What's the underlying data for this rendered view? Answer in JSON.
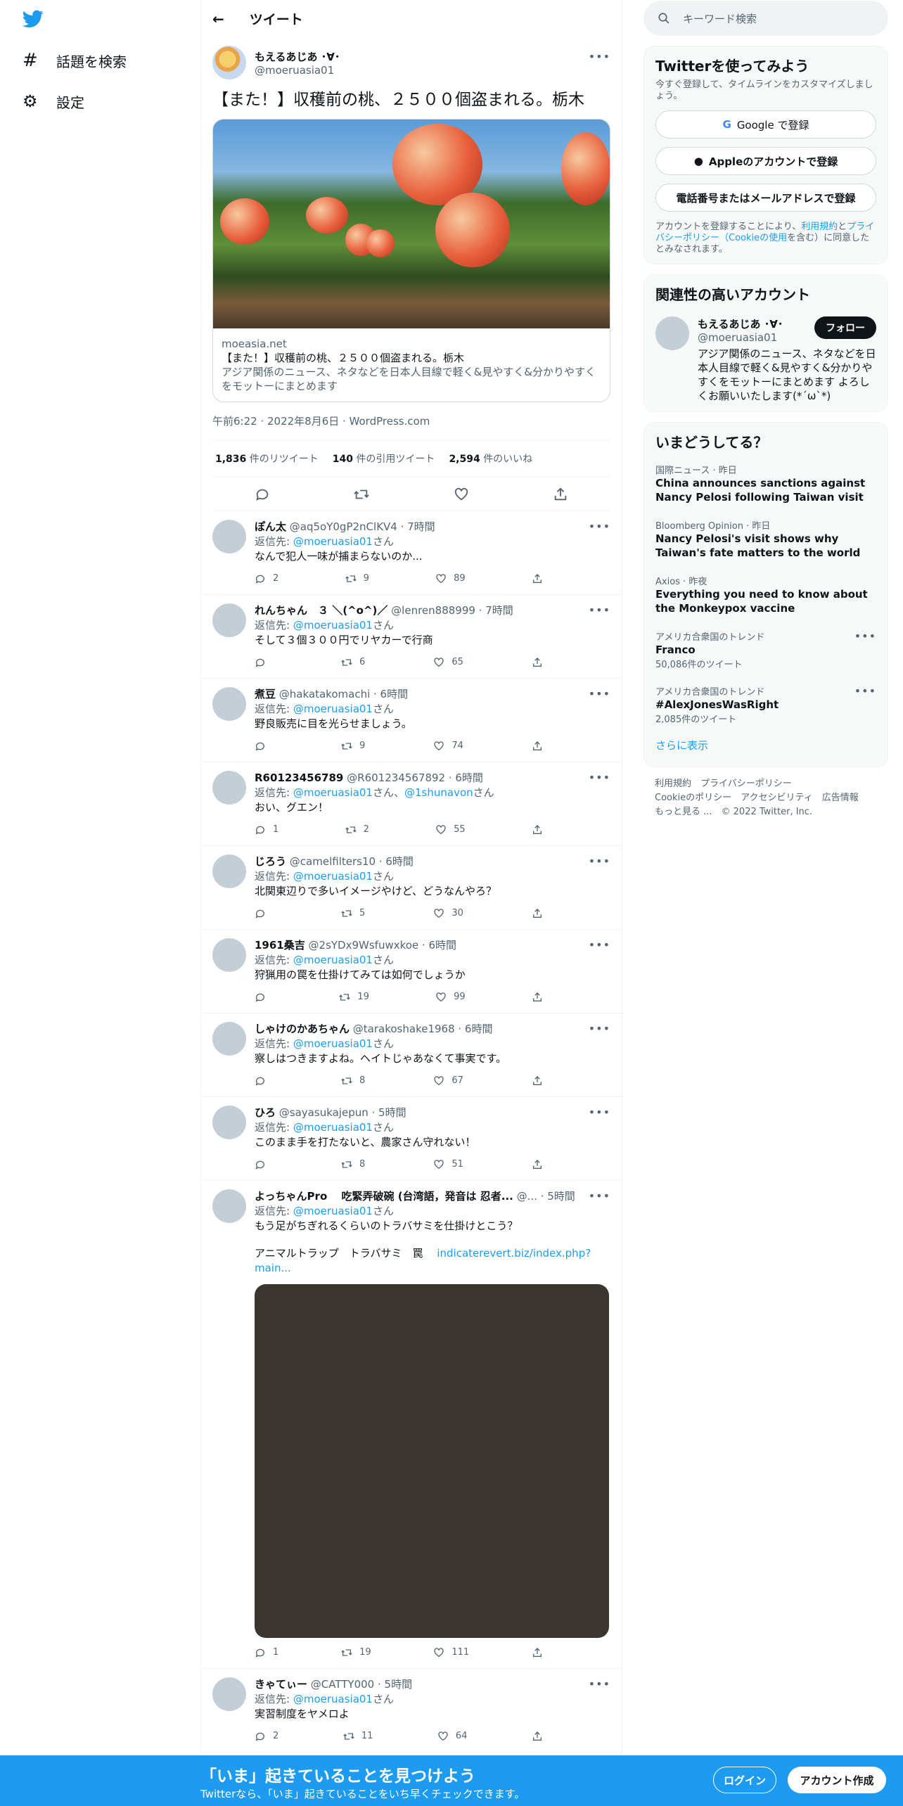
{
  "nav": {
    "explore": "話題を検索",
    "settings": "設定"
  },
  "header": {
    "title": "ツイート"
  },
  "main_tweet": {
    "name": "もえるあじあ ･∀･",
    "handle": "@moeruasia01",
    "text": "【また！】収穫前の桃、２５００個盗まれる。栃木",
    "card_domain": "moeasia.net",
    "card_title": "【また！】収穫前の桃、２５００個盗まれる。栃木",
    "card_desc": "アジア関係のニュース、ネタなどを日本人目線で軽く&見やすく&分かりやすくをモットーにまとめます",
    "meta": "午前6:22 · 2022年8月6日 · WordPress.com",
    "retweets": "1,836",
    "retweets_label": "件のリツイート",
    "quotes": "140",
    "quotes_label": "件の引用ツイート",
    "likes": "2,594",
    "likes_label": "件のいいね"
  },
  "replies": [
    {
      "name": "ぽん太",
      "handle": "@aq5oY0gP2nClKV4 · 7時間",
      "to": "@moeruasia01",
      "to2": "",
      "text": "なんで犯人一味が捕まらないのか...",
      "r": "2",
      "rt": "9",
      "l": "89"
    },
    {
      "name": "れんちゃん　３ ＼(^o^)／",
      "handle": "@lenren888999 · 7時間",
      "to": "@moeruasia01",
      "to2": "",
      "text": "そして３個３００円でリヤカーで行商",
      "r": "",
      "rt": "6",
      "l": "65"
    },
    {
      "name": "煮豆",
      "handle": "@hakatakomachi · 6時間",
      "to": "@moeruasia01",
      "to2": "",
      "text": "野良販売に目を光らせましょう。",
      "r": "",
      "rt": "9",
      "l": "74"
    },
    {
      "name": "R60123456789",
      "handle": "@R601234567892 · 6時間",
      "to": "@moeruasia01",
      "to2": "@1shunavon",
      "text": "おい、グエン！",
      "r": "1",
      "rt": "2",
      "l": "55"
    },
    {
      "name": "じろう",
      "handle": "@camelfilters10 · 6時間",
      "to": "@moeruasia01",
      "to2": "",
      "text": "北関東辺りで多いイメージやけど、どうなんやろ？",
      "r": "",
      "rt": "5",
      "l": "30"
    },
    {
      "name": "1961桑吉",
      "handle": "@2sYDx9Wsfuwxkoe · 6時間",
      "to": "@moeruasia01",
      "to2": "",
      "text": "狩猟用の罠を仕掛けてみては如何でしょうか",
      "r": "",
      "rt": "19",
      "l": "99"
    },
    {
      "name": "しゃけのかあちゃん",
      "handle": "@tarakoshake1968 · 6時間",
      "to": "@moeruasia01",
      "to2": "",
      "text": "察しはつきますよね。ヘイトじゃあなくて事実です。",
      "r": "",
      "rt": "8",
      "l": "67"
    },
    {
      "name": "ひろ",
      "handle": "@sayasukajepun · 5時間",
      "to": "@moeruasia01",
      "to2": "",
      "text": "このまま手を打たないと、農家さん守れない！",
      "r": "",
      "rt": "8",
      "l": "51"
    }
  ],
  "long_reply": {
    "name": "よっちゃんPro　 吃緊弄破碗 (台湾語，発音は 忍者...",
    "handle": "@... · 5時間",
    "to": "@moeruasia01",
    "text": "もう足がちぎれるくらいのトラバサミを仕掛けとこう？",
    "text2": "アニマルトラップ　トラバサミ　罠",
    "link": "indicaterevert.biz/index.php?main...",
    "r": "1",
    "rt": "19",
    "l": "111"
  },
  "last_reply": {
    "name": "きゃてぃー",
    "handle": "@CATTY000 · 5時間",
    "to": "@moeruasia01",
    "text": "実習制度をヤメロよ",
    "r": "2",
    "rt": "11",
    "l": "64"
  },
  "reply_prefix": "返信先: ",
  "reply_suffix": "さん",
  "reply_and": "さん、",
  "search": {
    "placeholder": "キーワード検索"
  },
  "signup_box": {
    "title": "Twitterを使ってみよう",
    "sub": "今すぐ登録して、タイムラインをカスタマイズしましょう。",
    "google": "Google で登録",
    "apple": "Appleのアカウントで登録",
    "phone": "電話番号またはメールアドレスで登録",
    "legal1": "アカウントを登録することにより、",
    "terms": "利用規約",
    "and": "と",
    "privacy": "プライバシーポリシー（Cookieの使用",
    "legal2": "を含む）に同意したとみなされます。"
  },
  "related": {
    "title": "関連性の高いアカウント",
    "name": "もえるあじあ ･∀･",
    "handle": "@moeruasia01",
    "follow": "フォロー",
    "bio": "アジア関係のニュース、ネタなどを日本人目線で軽く&見やすく&分かりやすくをモットーにまとめます よろしくお願いいたします(*´ω`*)"
  },
  "trends": {
    "title": "いまどうしてる？",
    "items": [
      {
        "t1": "国際ニュース · 昨日",
        "t2": "China announces sanctions against Nancy Pelosi following Taiwan visit",
        "t3": ""
      },
      {
        "t1": "Bloomberg Opinion · 昨日",
        "t2": "Nancy Pelosi's visit shows why Taiwan's fate matters to the world",
        "t3": ""
      },
      {
        "t1": "Axios · 昨夜",
        "t2": "Everything you need to know about the Monkeypox vaccine",
        "t3": ""
      },
      {
        "t1": "アメリカ合衆国のトレンド",
        "t2": "Franco",
        "t3": "50,086件のツイート"
      },
      {
        "t1": "アメリカ合衆国のトレンド",
        "t2": "#AlexJonesWasRight",
        "t3": "2,085件のツイート"
      }
    ],
    "more": "さらに表示"
  },
  "footer": {
    "l1": "利用規約　プライバシーポリシー",
    "l2": "Cookieのポリシー　アクセシビリティ　広告情報",
    "l3": "もっと見る ...　© 2022 Twitter, Inc."
  },
  "bottom": {
    "title": "「いま」起きていることを見つけよう",
    "sub": "Twitterなら、「いま」起きていることをいち早くチェックできます。",
    "login": "ログイン",
    "signup": "アカウント作成"
  },
  "colors": {
    "accent": "#1d9bf0",
    "text": "#0f1419",
    "muted": "#536471"
  }
}
